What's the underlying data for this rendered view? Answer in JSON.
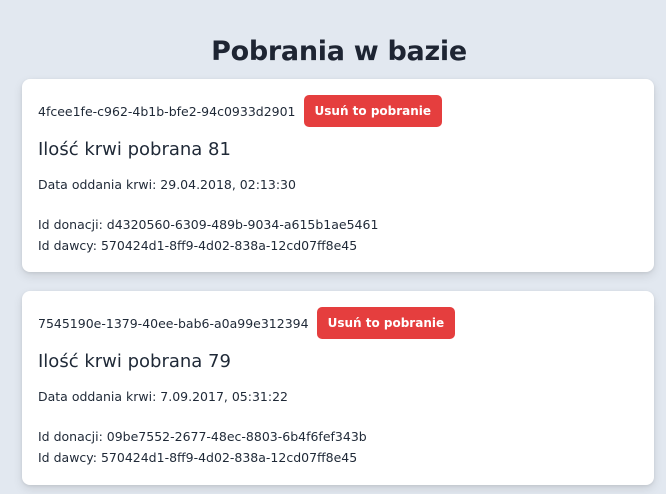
{
  "page": {
    "title": "Pobrania w bazie"
  },
  "common": {
    "delete_label": "Usuń to pobranie",
    "amount_prefix": "Ilość krwi pobrana ",
    "date_prefix": "Data oddania krwi: ",
    "donation_prefix": "Id donacji: ",
    "donor_prefix": "Id dawcy: "
  },
  "donations": [
    {
      "id": "4fcee1fe-c962-4b1b-bfe2-94c0933d2901",
      "amount_text": "Ilość krwi pobrana 81",
      "amount": 81,
      "date_text": "Data oddania krwi: 29.04.2018, 02:13:30",
      "donation_id_text": "Id donacji: d4320560-6309-489b-9034-a615b1ae5461",
      "donor_id_text": "Id dawcy: 570424d1-8ff9-4d02-838a-12cd07ff8e45"
    },
    {
      "id": "7545190e-1379-40ee-bab6-a0a99e312394",
      "amount_text": "Ilość krwi pobrana 79",
      "amount": 79,
      "date_text": "Data oddania krwi: 7.09.2017, 05:31:22",
      "donation_id_text": "Id donacji: 09be7552-2677-48ec-8803-6b4f6fef343b",
      "donor_id_text": "Id dawcy: 570424d1-8ff9-4d02-838a-12cd07ff8e45"
    }
  ],
  "colors": {
    "background": "#e2e8f0",
    "card": "#ffffff",
    "danger": "#e53e3e",
    "text": "#1f2937"
  }
}
